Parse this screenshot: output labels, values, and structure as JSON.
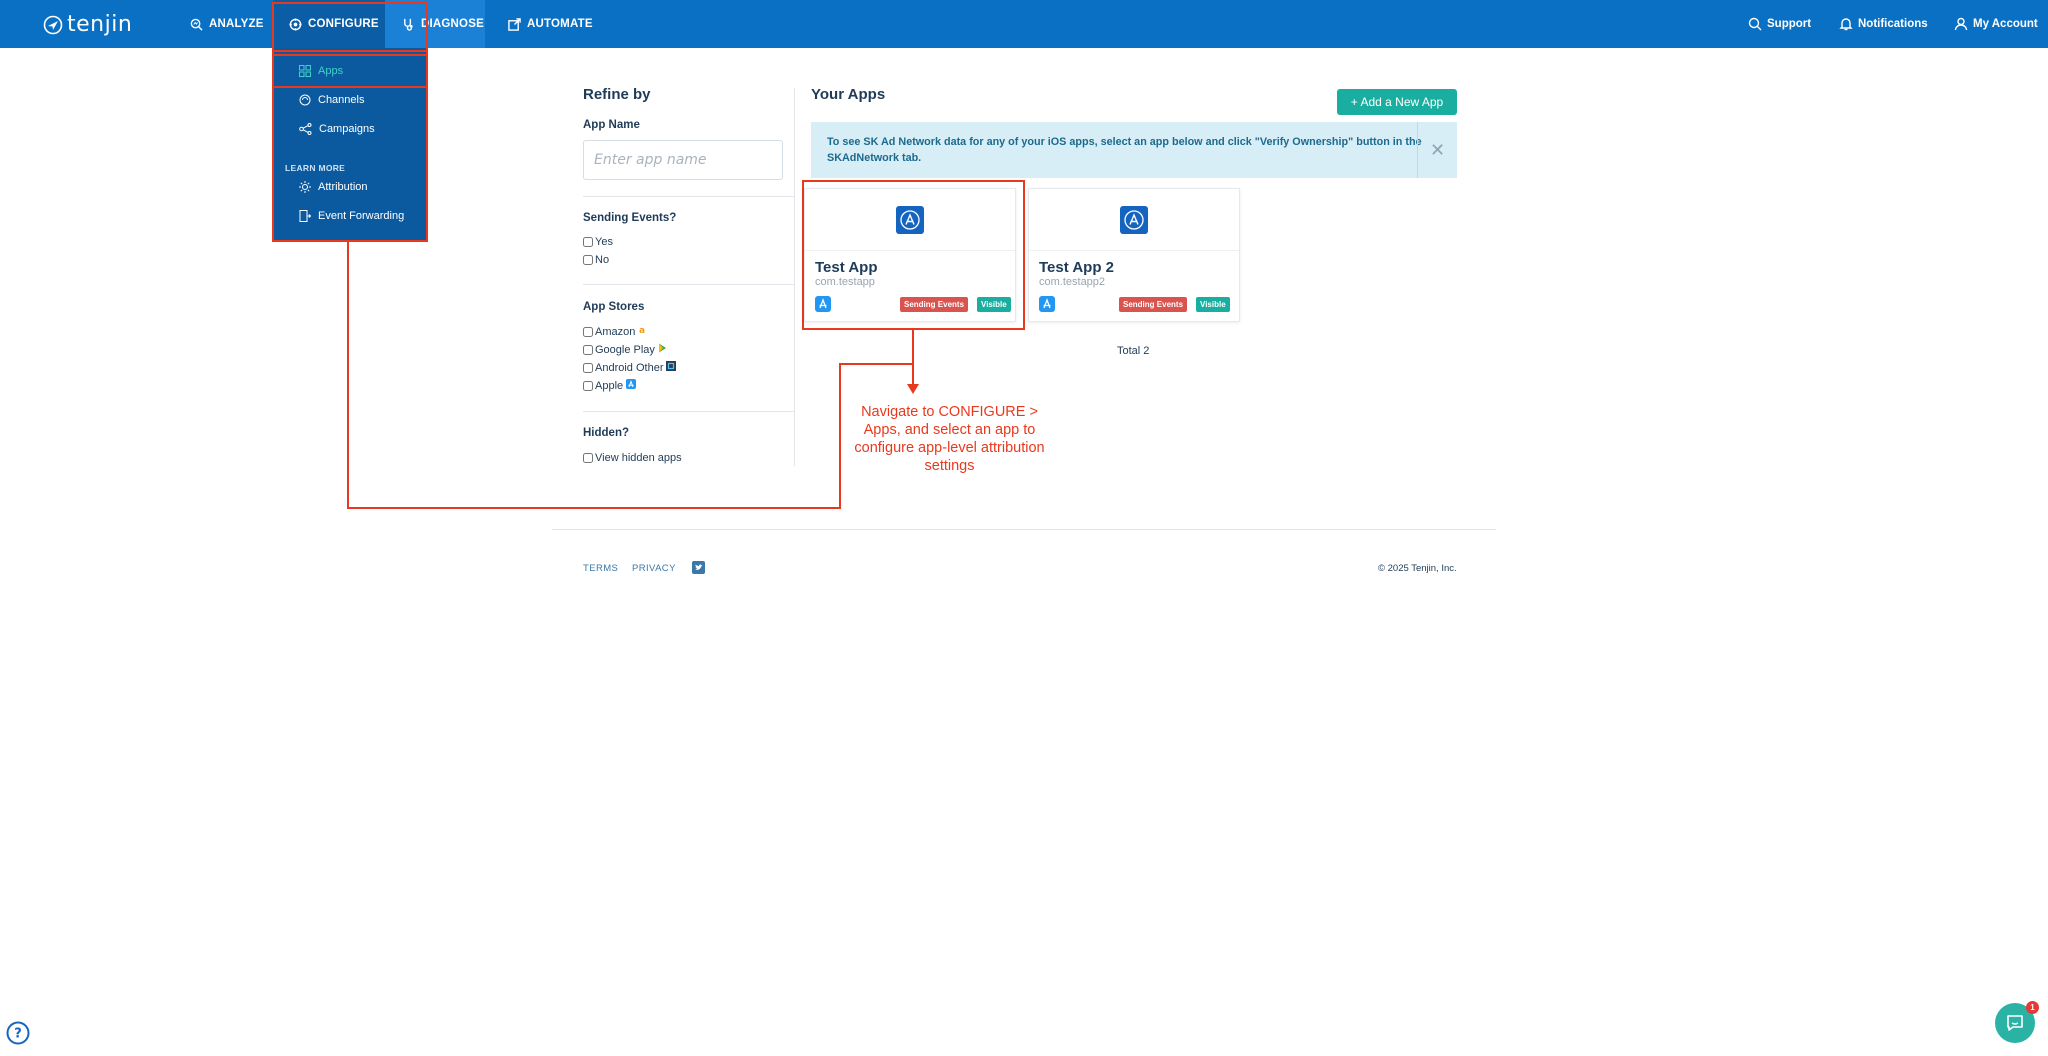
{
  "brand": {
    "name": "tenjin"
  },
  "topnav": {
    "items": [
      {
        "label": "ANALYZE",
        "icon": "analyze-icon"
      },
      {
        "label": "CONFIGURE",
        "icon": "configure-icon"
      },
      {
        "label": "DIAGNOSE",
        "icon": "diagnose-icon"
      },
      {
        "label": "AUTOMATE",
        "icon": "automate-icon"
      }
    ],
    "right": [
      {
        "label": "Support",
        "icon": "support-icon"
      },
      {
        "label": "Notifications",
        "icon": "bell-icon"
      },
      {
        "label": "My Account",
        "icon": "user-icon"
      }
    ]
  },
  "dropdown": {
    "items": [
      {
        "label": "Apps",
        "icon": "grid-icon",
        "active": true
      },
      {
        "label": "Channels",
        "icon": "channels-icon"
      },
      {
        "label": "Campaigns",
        "icon": "campaigns-icon"
      }
    ],
    "learn_more_label": "LEARN MORE",
    "learn_items": [
      {
        "label": "Attribution",
        "icon": "attribution-icon"
      },
      {
        "label": "Event Forwarding",
        "icon": "event-forwarding-icon"
      }
    ]
  },
  "filters": {
    "title": "Refine by",
    "app_name_label": "App Name",
    "app_name_placeholder": "Enter app name",
    "app_name_value": "",
    "sending_events_label": "Sending Events?",
    "sending_events_options": [
      "Yes",
      "No"
    ],
    "app_stores_label": "App Stores",
    "app_stores_options": [
      "Amazon",
      "Google Play",
      "Android Other",
      "Apple"
    ],
    "hidden_label": "Hidden?",
    "hidden_option": "View hidden apps"
  },
  "apps": {
    "title": "Your Apps",
    "add_button": "+ Add a New App",
    "alert_text": "To see SK Ad Network data for any of your iOS apps, select an app below and click \"Verify Ownership\" button in the SKAdNetwork tab.",
    "alert_close": "✕",
    "cards": [
      {
        "name": "Test App",
        "bundle": "com.testapp",
        "badges": [
          "Sending Events",
          "Visible"
        ]
      },
      {
        "name": "Test App 2",
        "bundle": "com.testapp2",
        "badges": [
          "Sending Events",
          "Visible"
        ]
      }
    ],
    "total": "Total 2"
  },
  "annotation": {
    "text": "Navigate to CONFIGURE > Apps, and select an app to configure app-level attribution settings",
    "color": "#e8391e"
  },
  "footer": {
    "terms": "TERMS",
    "privacy": "PRIVACY",
    "copyright": "© 2025 Tenjin, Inc."
  },
  "chat": {
    "unread_count": "1"
  },
  "colors": {
    "nav_bg": "#0a70c4",
    "dropdown_bg": "#0b5aa0",
    "accent_teal": "#1aaea0",
    "badge_red": "#d9534f",
    "alert_bg": "#d8eef7"
  }
}
